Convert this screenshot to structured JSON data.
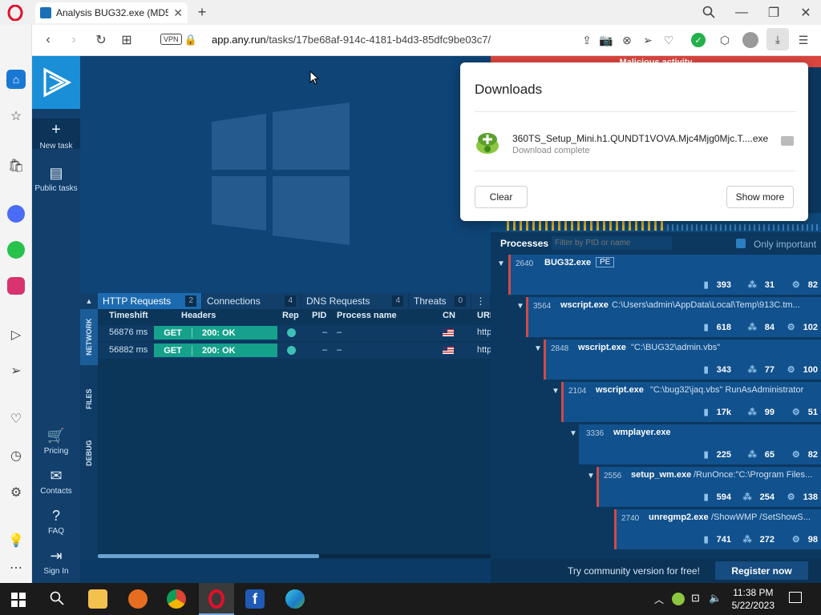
{
  "browser": {
    "tab_title": "Analysis BUG32.exe (MD5:",
    "url_host": "app.any.run",
    "url_path": "/tasks/17be68af-914c-4181-b4d3-85dfc9be03c7/",
    "vpn_label": "VPN"
  },
  "app_sidebar": {
    "new_task": "New task",
    "public_tasks": "Public tasks",
    "pricing": "Pricing",
    "contacts": "Contacts",
    "faq": "FAQ",
    "sign_in": "Sign In"
  },
  "banner": {
    "malicious": "Malicious activity"
  },
  "network": {
    "tabs": [
      {
        "label": "HTTP Requests",
        "count": "2"
      },
      {
        "label": "Connections",
        "count": "4"
      },
      {
        "label": "DNS Requests",
        "count": "4"
      },
      {
        "label": "Threats",
        "count": "0"
      }
    ],
    "vtabs": [
      "NETWORK",
      "FILES",
      "DEBUG"
    ],
    "columns": [
      "Timeshift",
      "Headers",
      "Rep",
      "PID",
      "Process name",
      "CN",
      "URL"
    ],
    "rows": [
      {
        "time": "56876 ms",
        "method": "GET",
        "status": "200: OK",
        "pid": "–",
        "proc": "–",
        "url": "http"
      },
      {
        "time": "56882 ms",
        "method": "GET",
        "status": "200: OK",
        "pid": "–",
        "proc": "–",
        "url": "http"
      }
    ]
  },
  "processes": {
    "title": "Processes",
    "filter_placeholder": "Filter by PID or name",
    "only_important": "Only important",
    "items": [
      {
        "pid": "2640",
        "name": "BUG32.exe",
        "cmd": "",
        "tag": "PE",
        "files": "393",
        "reg": "31",
        "mod": "82"
      },
      {
        "pid": "3564",
        "name": "wscript.exe",
        "cmd": "C:\\Users\\admin\\AppData\\Local\\Temp\\913C.tm...",
        "tag": "",
        "files": "618",
        "reg": "84",
        "mod": "102"
      },
      {
        "pid": "2848",
        "name": "wscript.exe",
        "cmd": "\"C:\\BUG32\\admin.vbs\"",
        "tag": "",
        "files": "343",
        "reg": "77",
        "mod": "100"
      },
      {
        "pid": "2104",
        "name": "wscript.exe",
        "cmd": "\"C:\\bug32\\jaq.vbs\" RunAsAdministrator",
        "tag": "",
        "files": "17k",
        "reg": "99",
        "mod": "51"
      },
      {
        "pid": "3336",
        "name": "wmplayer.exe",
        "cmd": "",
        "tag": "",
        "files": "225",
        "reg": "65",
        "mod": "82"
      },
      {
        "pid": "2556",
        "name": "setup_wm.exe",
        "cmd": "/RunOnce:\"C:\\Program Files...",
        "tag": "",
        "files": "594",
        "reg": "254",
        "mod": "138"
      },
      {
        "pid": "2740",
        "name": "unregmp2.exe",
        "cmd": "/ShowWMP /SetShowS...",
        "tag": "",
        "files": "741",
        "reg": "272",
        "mod": "98"
      }
    ]
  },
  "footer": {
    "community": "Try community version for free!",
    "register": "Register now"
  },
  "downloads": {
    "title": "Downloads",
    "file_name": "360TS_Setup_Mini.h1.QUNDT1VOVA.Mjc4Mjg0Mjc.T....exe",
    "status": "Download complete",
    "clear": "Clear",
    "show_more": "Show more"
  },
  "taskbar": {
    "time": "11:38 PM",
    "date": "5/22/2023"
  }
}
